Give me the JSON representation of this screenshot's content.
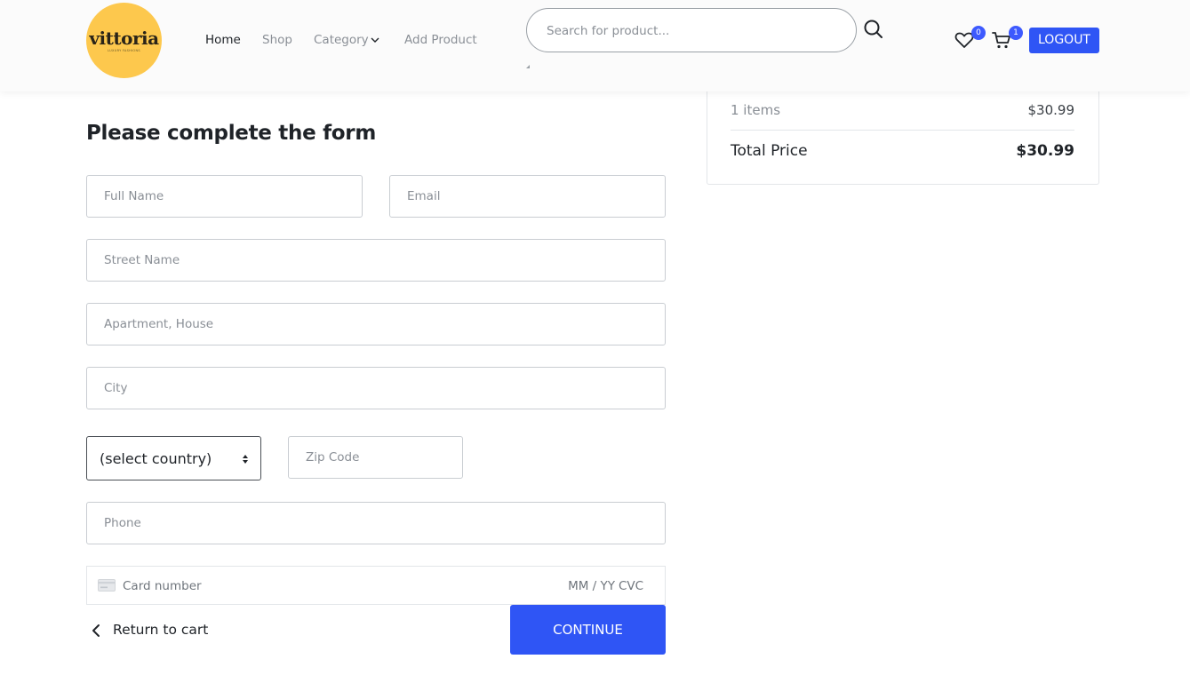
{
  "colors": {
    "accent": "#2f55f5",
    "badge": "#3d5afe",
    "logo_bg": "#fdc84d"
  },
  "header": {
    "logo": {
      "text": "vittoria",
      "tagline": "LUXURY FASHIONS"
    },
    "nav": [
      {
        "label": "Home",
        "active": true
      },
      {
        "label": "Shop",
        "active": false
      },
      {
        "label": "Category",
        "active": false,
        "has_dropdown": true
      },
      {
        "label": "Add Product",
        "active": false
      }
    ],
    "search": {
      "placeholder": "Search for product...",
      "value": ""
    },
    "icons": {
      "search": "search-icon",
      "wishlist": "heart-icon",
      "cart": "cart-icon",
      "dropdown": "chevron-down-icon"
    },
    "wishlist_count": "0",
    "cart_count": "1",
    "logout_label": "LOGOUT"
  },
  "form": {
    "title": "Please complete the form",
    "fields": {
      "full_name": {
        "placeholder": "Full Name",
        "value": ""
      },
      "email": {
        "placeholder": "Email",
        "value": ""
      },
      "street": {
        "placeholder": "Street Name",
        "value": ""
      },
      "apartment": {
        "placeholder": "Apartment, House",
        "value": ""
      },
      "city": {
        "placeholder": "City",
        "value": ""
      },
      "zip": {
        "placeholder": "Zip Code",
        "value": ""
      },
      "phone": {
        "placeholder": "Phone",
        "value": ""
      }
    },
    "country": {
      "selected": "(select country)"
    },
    "card": {
      "number_placeholder": "Card number",
      "expiry_placeholder": "MM / YY",
      "cvc_placeholder": "CVC"
    },
    "return_label": "Return to cart",
    "continue_label": "CONTINUE"
  },
  "summary": {
    "items_label": "1 items",
    "items_price": "$30.99",
    "total_label": "Total Price",
    "total_price": "$30.99"
  }
}
